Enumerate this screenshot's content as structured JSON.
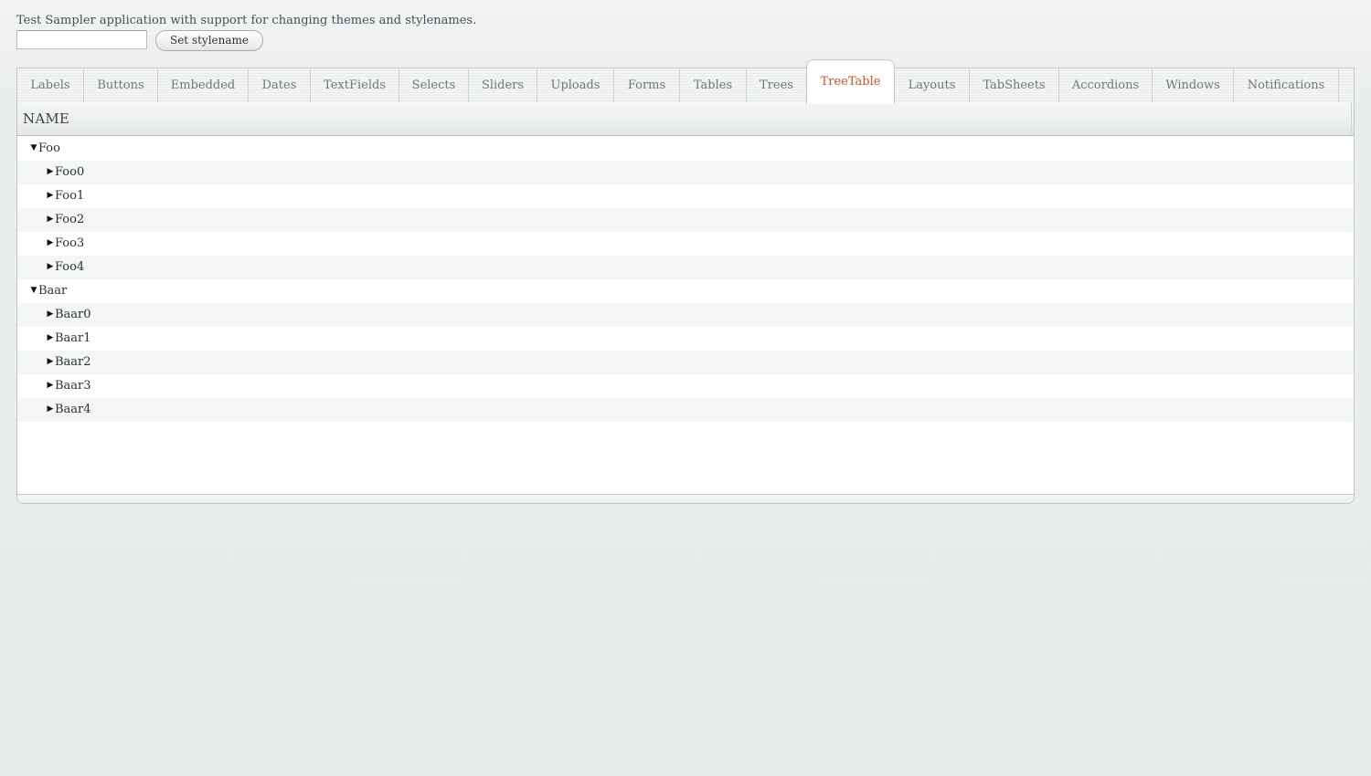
{
  "caption": "Test Sampler application with support for changing themes and stylenames.",
  "stylename_input": {
    "value": "",
    "placeholder": ""
  },
  "set_stylename_label": "Set stylename",
  "tabs": [
    {
      "label": "Labels"
    },
    {
      "label": "Buttons"
    },
    {
      "label": "Embedded"
    },
    {
      "label": "Dates"
    },
    {
      "label": "TextFields"
    },
    {
      "label": "Selects"
    },
    {
      "label": "Sliders"
    },
    {
      "label": "Uploads"
    },
    {
      "label": "Forms"
    },
    {
      "label": "Tables"
    },
    {
      "label": "Trees"
    },
    {
      "label": "TreeTable",
      "selected": true
    },
    {
      "label": "Layouts"
    },
    {
      "label": "TabSheets"
    },
    {
      "label": "Accordions"
    },
    {
      "label": "Windows"
    },
    {
      "label": "Notifications"
    }
  ],
  "treetable": {
    "column_header": "NAME",
    "rows": [
      {
        "label": "Foo",
        "level": 0,
        "expanded": true
      },
      {
        "label": "Foo0",
        "level": 1,
        "expanded": false
      },
      {
        "label": "Foo1",
        "level": 1,
        "expanded": false
      },
      {
        "label": "Foo2",
        "level": 1,
        "expanded": false
      },
      {
        "label": "Foo3",
        "level": 1,
        "expanded": false
      },
      {
        "label": "Foo4",
        "level": 1,
        "expanded": false
      },
      {
        "label": "Baar",
        "level": 0,
        "expanded": true
      },
      {
        "label": "Baar0",
        "level": 1,
        "expanded": false
      },
      {
        "label": "Baar1",
        "level": 1,
        "expanded": false
      },
      {
        "label": "Baar2",
        "level": 1,
        "expanded": false
      },
      {
        "label": "Baar3",
        "level": 1,
        "expanded": false
      },
      {
        "label": "Baar4",
        "level": 1,
        "expanded": false
      }
    ]
  },
  "colors": {
    "selected_tab_text": "#d5501f",
    "tab_text": "#6f7779",
    "body_text": "#2b3133"
  }
}
